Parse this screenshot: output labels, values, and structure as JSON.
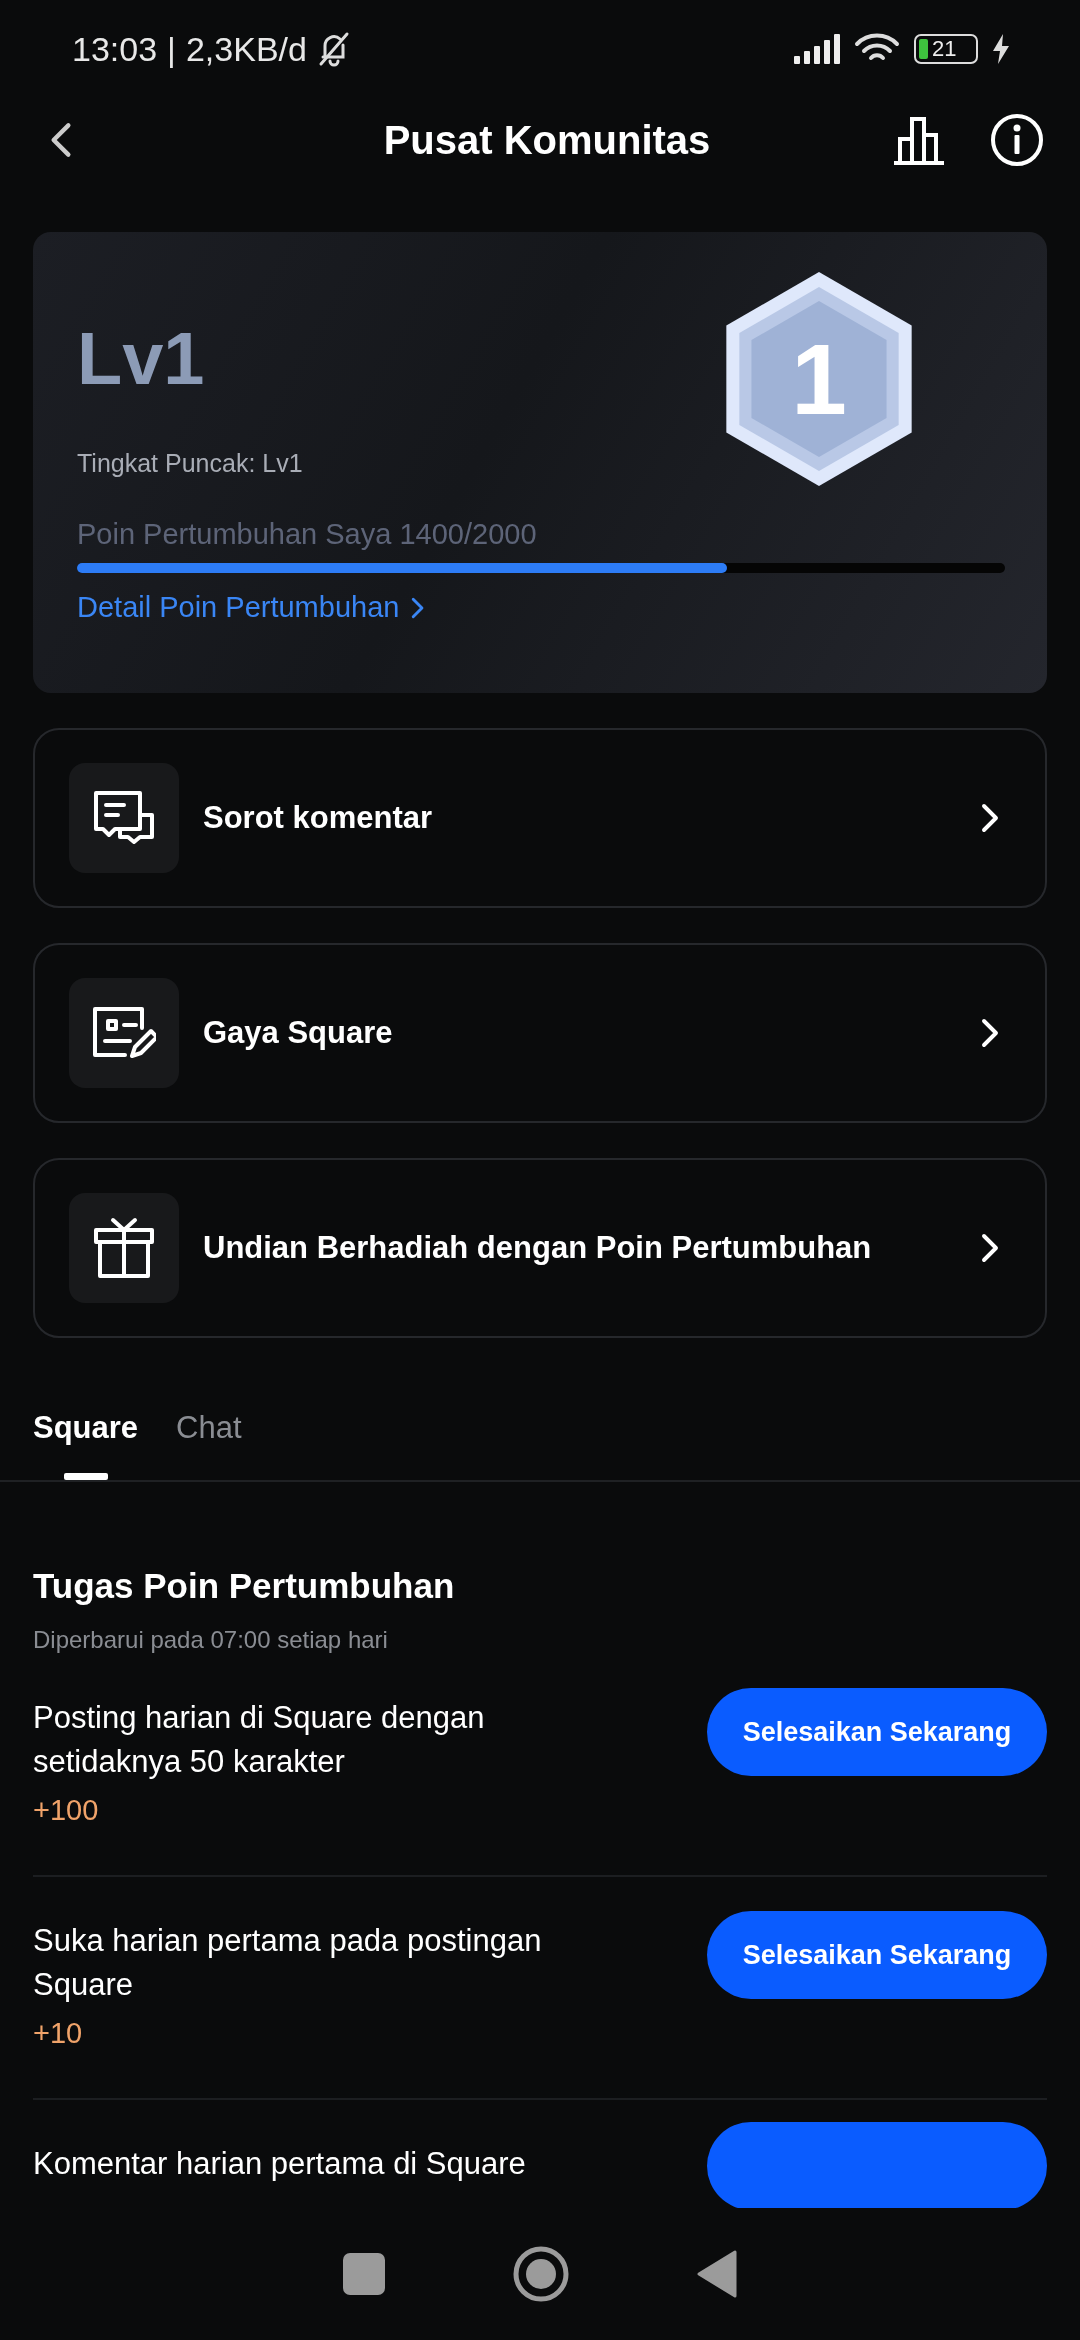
{
  "status_bar": {
    "time": "13:03",
    "separator": "|",
    "speed": "2,3KB/d",
    "battery": "21"
  },
  "header": {
    "title": "Pusat Komunitas"
  },
  "level_card": {
    "level": "Lv1",
    "badge_number": "1",
    "peak": "Tingkat Puncak: Lv1",
    "progress_label": "Poin Pertumbuhan Saya 1400/2000",
    "progress": {
      "level": 0.7
    },
    "detail_link": "Detail Poin Pertumbuhan"
  },
  "menu": [
    {
      "kind": "comments",
      "label": "Sorot komentar"
    },
    {
      "kind": "card",
      "label": "Gaya Square"
    },
    {
      "kind": "gift",
      "label": "Undian Berhadiah dengan Poin Pertumbuhan"
    }
  ],
  "tabs": [
    {
      "label": "Square",
      "selected": true
    },
    {
      "label": "Chat",
      "selected": false
    }
  ],
  "tasks_section": {
    "title": "Tugas Poin Pertumbuhan",
    "subtitle": "Diperbarui pada 07:00 setiap hari",
    "tasks": [
      {
        "text": "Posting harian di Square dengan setidaknya 50 karakter",
        "points": "+100",
        "action": {
          "kind": "button",
          "label": "Selesaikan Sekarang"
        }
      },
      {
        "text": "Suka harian pertama pada postingan Square",
        "points": "+10",
        "action": {
          "kind": "button",
          "label": "Selesaikan Sekarang"
        }
      },
      {
        "text": "Komentar harian pertama di Square",
        "action": {
          "kind": "button-edge"
        }
      }
    ]
  }
}
